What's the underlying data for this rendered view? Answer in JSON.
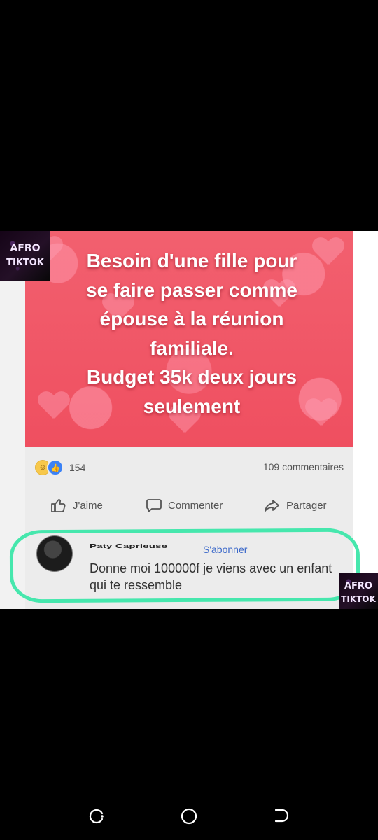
{
  "post": {
    "poster_text": "Besoin d'une fille pour\nse faire passer comme\népouse à la réunion\nfamiliale.\nBudget 35k deux jours\nseulement",
    "reaction_count": "154",
    "comments_count": "109 commentaires",
    "reaction_icons": [
      "haha-icon",
      "like-icon"
    ]
  },
  "actions": {
    "like": "J'aime",
    "comment": "Commenter",
    "share": "Partager"
  },
  "comment": {
    "author": "Paty Caprieuse",
    "subscribe": "S'abonner",
    "text": "Donne moi 100000f je viens avec un enfant  qui te ressemble"
  },
  "badges": {
    "top": {
      "line1": "AFRO",
      "line2": "TIKTOK"
    },
    "bottom": {
      "line1": "AFRO",
      "line2": "TIKTOK"
    }
  },
  "navigation": {
    "items": [
      "recent-apps-icon",
      "home-icon",
      "back-icon"
    ]
  },
  "colors": {
    "background": "#000000",
    "poster": "#ef4f60",
    "highlight": "#46e7ad",
    "link": "#3b68c9"
  }
}
